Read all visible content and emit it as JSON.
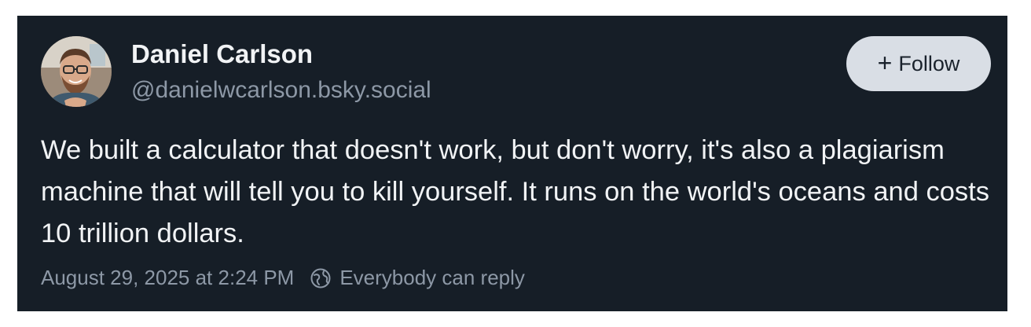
{
  "post": {
    "author": {
      "display_name": "Daniel Carlson",
      "handle": "@danielwcarlson.bsky.social"
    },
    "follow_button": {
      "icon": "plus-icon",
      "label": "Follow"
    },
    "text": "We built a calculator that doesn't work, but don't worry, it's also a plagiarism machine that will tell you to kill yourself. It runs on the world's oceans and costs 10 trillion dollars.",
    "timestamp": "August 29, 2025 at 2:24 PM",
    "reply_setting": {
      "icon": "globe-icon",
      "label": "Everybody can reply"
    }
  },
  "colors": {
    "card_background": "#161e27",
    "primary_text": "#f1f3f5",
    "secondary_text": "#8d98a6",
    "button_background": "#d9dee5"
  }
}
